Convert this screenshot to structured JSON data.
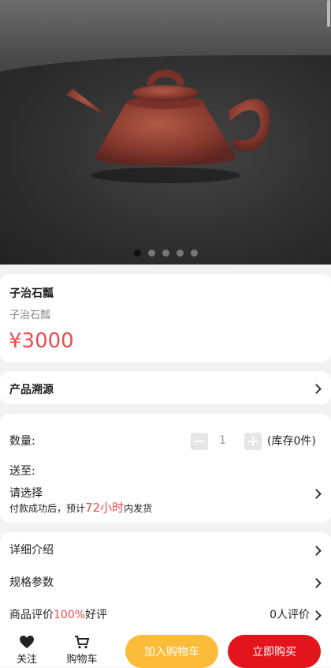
{
  "product": {
    "title": "子治石瓢",
    "subtitle": "子治石瓢",
    "price": "¥3000"
  },
  "gallery": {
    "active_index": 0,
    "count": 5
  },
  "trace": {
    "label": "产品溯源"
  },
  "purchase": {
    "qty_label": "数量:",
    "qty_value": "1",
    "stock": "(库存0件)",
    "ship_to_label": "送至:",
    "select_label": "请选择",
    "note_prefix": "付款成功后，预计",
    "note_highlight": "72小时",
    "note_suffix": "内发货"
  },
  "info": {
    "detail_label": "详细介绍",
    "spec_label": "规格参数",
    "review_prefix": "商品评价",
    "review_rate": "100%",
    "review_suffix": "好评",
    "review_count": "0人评价"
  },
  "bottom": {
    "favorite_label": "关注",
    "cart_label": "购物车",
    "add_to_cart": "加入购物车",
    "buy_now": "立即购买"
  },
  "colors": {
    "accent_red": "#ef4b4b",
    "cart_button": "#fdbb3a",
    "buy_button": "#e4141c"
  }
}
